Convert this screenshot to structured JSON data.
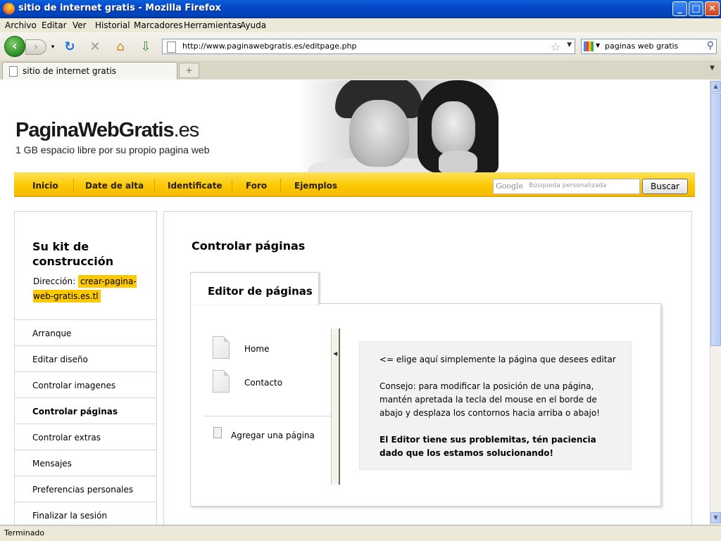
{
  "window": {
    "title": "sitio de internet gratis - Mozilla Firefox",
    "buttons": {
      "minimize": "_",
      "maximize": "□",
      "close": "✕"
    }
  },
  "menubar": [
    "Archivo",
    "Editar",
    "Ver",
    "Historial",
    "Marcadores",
    "Herramientas",
    "Ayuda"
  ],
  "toolbar": {
    "url": "http://www.paginawebgratis.es/editpage.php",
    "search_query": "paginas web gratis"
  },
  "tabs": [
    {
      "label": "sitio de internet gratis"
    }
  ],
  "status": "Terminado",
  "site": {
    "logo_main": "PaginaWebGratis",
    "logo_suffix": ".es",
    "tagline": "1 GB espacio libre por su propio pagina web",
    "nav": [
      "Inicio",
      "Date de alta",
      "Identificate",
      "Foro",
      "Ejemplos"
    ],
    "search_placeholder": "Búsqueda personalizada",
    "search_logo": "Google",
    "search_button": "Buscar"
  },
  "sidebar": {
    "title": "Su kit de construcción",
    "address_label": "Dirección:",
    "address_value": "crear-pagina-web-gratis.es.tl",
    "items": [
      {
        "label": "Arranque",
        "active": false
      },
      {
        "label": "Editar diseño",
        "active": false
      },
      {
        "label": "Controlar imagenes",
        "active": false
      },
      {
        "label": "Controlar páginas",
        "active": true
      },
      {
        "label": "Controlar extras",
        "active": false
      },
      {
        "label": "Mensajes",
        "active": false
      },
      {
        "label": "Preferencias personales",
        "active": false
      },
      {
        "label": "Finalizar la sesión",
        "active": false
      }
    ]
  },
  "main": {
    "heading": "Controlar páginas",
    "tab_label": "Editor de páginas",
    "pages": [
      "Home",
      "Contacto"
    ],
    "add_page": "Agregar una página",
    "info": {
      "hint": "<= elige aquí simplemente la página que desees editar",
      "tip": "Consejo: para modificar la posición de una página, mantén apretada la tecla del mouse en el borde de abajo y desplaza los contornos hacia arriba o abajo!",
      "warning": "El Editor tiene sus problemitas, tén paciencia dado que los estamos solucionando!"
    }
  },
  "colors": {
    "accent_yellow": "#fcc800",
    "titlebar_blue": "#0447c9"
  }
}
